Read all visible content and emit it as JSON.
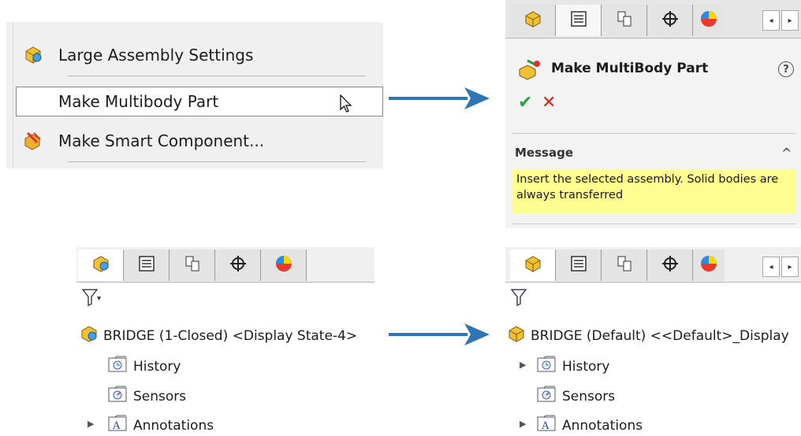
{
  "context_menu": {
    "items": [
      {
        "label": "Large Assembly Settings",
        "icon": "large-assembly-icon"
      },
      {
        "label": "Make Multibody Part",
        "icon": ""
      },
      {
        "label": "Make Smart Component...",
        "icon": "smart-component-icon"
      }
    ]
  },
  "property_manager": {
    "title": "Make MultiBody Part",
    "help_glyph": "?",
    "ok_glyph": "✔",
    "cancel_glyph": "✕",
    "message_header": "Message",
    "message_text": "Insert the selected assembly. Solid bodies are always transferred",
    "collapse_glyph": "^",
    "tab_icons": [
      "feature-manager-icon",
      "property-manager-icon",
      "configuration-manager-icon",
      "dimxpert-icon",
      "display-manager-icon"
    ],
    "scroll_left": "◂",
    "scroll_right": "▸"
  },
  "tree_before": {
    "filter_glyph": "▾",
    "root_label": "BRIDGE (1-Closed) <Display State-4>",
    "items": [
      {
        "label": "History",
        "icon": "history-folder-icon"
      },
      {
        "label": "Sensors",
        "icon": "sensors-folder-icon"
      },
      {
        "label": "Annotations",
        "icon": "annotations-folder-icon"
      }
    ]
  },
  "tree_after": {
    "root_label": "BRIDGE (Default) <<Default>_Display",
    "items": [
      {
        "label": "History",
        "icon": "history-folder-icon"
      },
      {
        "label": "Sensors",
        "icon": "sensors-folder-icon"
      },
      {
        "label": "Annotations",
        "icon": "annotations-folder-icon"
      }
    ],
    "scroll_left": "◂",
    "scroll_right": "▸"
  },
  "colors": {
    "arrow": "#2e75b6",
    "message_bg": "#fdfd90",
    "ok": "#2ea043",
    "cancel": "#d9261c"
  }
}
